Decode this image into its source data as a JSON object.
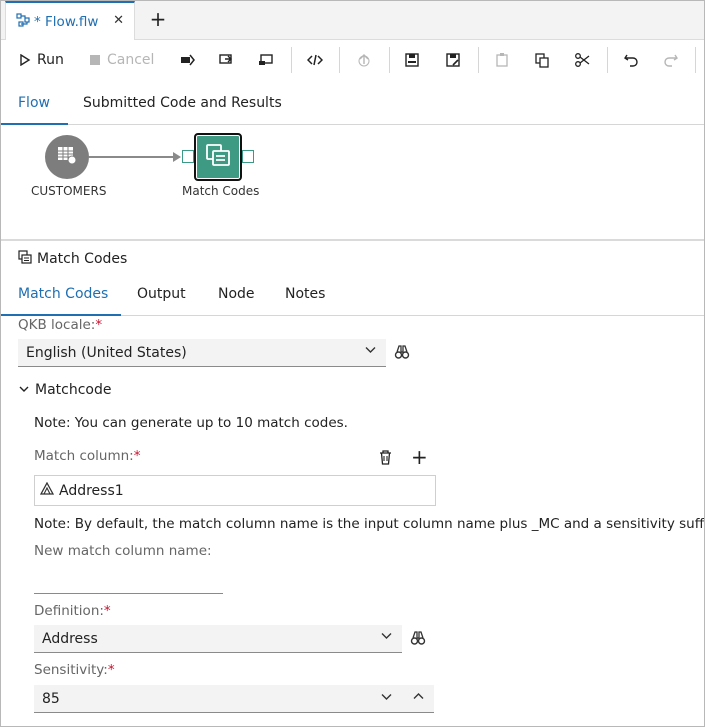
{
  "tab": {
    "title": "* Flow.flw",
    "icon": "flow-icon",
    "close_icon": "close-icon",
    "new_tab_icon": "plus-icon"
  },
  "toolbar": {
    "run_label": "Run",
    "cancel_label": "Cancel",
    "icons": [
      "run-selected-icon",
      "run-from-node-icon",
      "run-to-node-icon",
      "code-view-icon",
      "upload-icon",
      "save-icon",
      "save-as-icon",
      "paste-icon",
      "copy-icon",
      "cut-icon",
      "undo-icon",
      "redo-icon"
    ]
  },
  "nav": {
    "tabs": [
      {
        "label": "Flow",
        "active": true
      },
      {
        "label": "Submitted Code and Results",
        "active": false
      }
    ]
  },
  "flow": {
    "nodes": [
      {
        "label": "CUSTOMERS",
        "icon": "table-icon"
      },
      {
        "label": "Match Codes",
        "icon": "match-codes-icon"
      }
    ]
  },
  "properties": {
    "title": "Match Codes",
    "title_icon": "match-codes-icon",
    "tabs": [
      {
        "label": "Match Codes",
        "active": true
      },
      {
        "label": "Output",
        "active": false
      },
      {
        "label": "Node",
        "active": false
      },
      {
        "label": "Notes",
        "active": false
      }
    ],
    "qkb_locale": {
      "label": "QKB locale:",
      "required_mark": "*",
      "value": "English (United States)"
    },
    "matchcode_section": {
      "title": "Matchcode",
      "note": "Note: You can generate up to 10 match codes.",
      "match_column": {
        "label": "Match column:",
        "required_mark": "*",
        "value": "Address1"
      },
      "default_note": "Note: By default, the match column name is the input column name plus _MC and a sensitivity suffix.",
      "new_name": {
        "label": "New match column name:",
        "value": ""
      },
      "definition": {
        "label": "Definition:",
        "required_mark": "*",
        "value": "Address"
      },
      "sensitivity": {
        "label": "Sensitivity:",
        "required_mark": "*",
        "value": "85"
      }
    }
  },
  "colors": {
    "accent": "#1f6fb2",
    "node_green": "#3f9a84",
    "node_gray": "#7d7d7d",
    "required": "#c8102e"
  }
}
